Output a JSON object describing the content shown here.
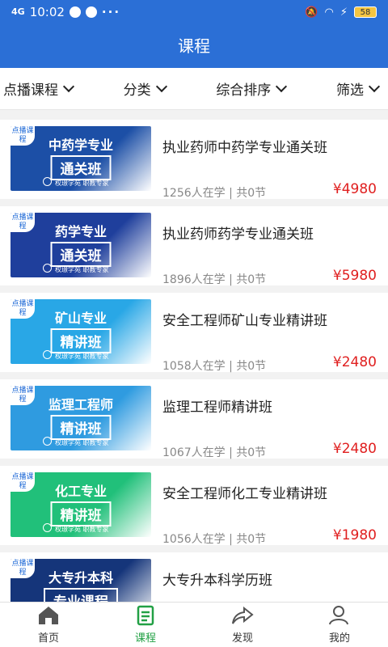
{
  "status": {
    "time": "10:02",
    "signal": "4G",
    "battery": "58"
  },
  "header": {
    "title": "课程"
  },
  "filters": [
    {
      "label": "点播课程"
    },
    {
      "label": "分类"
    },
    {
      "label": "综合排序"
    },
    {
      "label": "筛选"
    }
  ],
  "courses": [
    {
      "tag": "点播课程",
      "thumb_line1": "中药学专业",
      "thumb_line2": "通关班",
      "brand": "权璟学苑 职教专家",
      "name": "执业药师中药学专业通关班",
      "meta": "1256人在学 | 共0节",
      "price": "¥4980",
      "color": "#1c4fa6"
    },
    {
      "tag": "点播课程",
      "thumb_line1": "药学专业",
      "thumb_line2": "通关班",
      "brand": "权璟学苑 职教专家",
      "name": "执业药师药学专业通关班",
      "meta": "1896人在学 | 共0节",
      "price": "¥5980",
      "color": "#1f3f9c"
    },
    {
      "tag": "点播课程",
      "thumb_line1": "矿山专业",
      "thumb_line2": "精讲班",
      "brand": "权璟学苑 职教专家",
      "name": "安全工程师矿山专业精讲班",
      "meta": "1058人在学 | 共0节",
      "price": "¥2480",
      "color": "#29a7e6"
    },
    {
      "tag": "点播课程",
      "thumb_line1": "监理工程师",
      "thumb_line2": "精讲班",
      "brand": "权璟学苑 职教专家",
      "name": "监理工程师精讲班",
      "meta": "1067人在学 | 共0节",
      "price": "¥2480",
      "color": "#2f9be0"
    },
    {
      "tag": "点播课程",
      "thumb_line1": "化工专业",
      "thumb_line2": "精讲班",
      "brand": "权璟学苑 职教专家",
      "name": "安全工程师化工专业精讲班",
      "meta": "1056人在学 | 共0节",
      "price": "¥1980",
      "color": "#21c07a"
    },
    {
      "tag": "点播课程",
      "thumb_line1": "大专升本科",
      "thumb_line2": "专业课程",
      "brand": "",
      "name": "大专升本科学历班",
      "meta": "",
      "price": "",
      "color": "#15357a"
    }
  ],
  "nav": [
    {
      "label": "首页",
      "icon": "home-icon"
    },
    {
      "label": "课程",
      "icon": "course-icon"
    },
    {
      "label": "发现",
      "icon": "share-icon"
    },
    {
      "label": "我的",
      "icon": "user-icon"
    }
  ],
  "colors": {
    "primary": "#2b6fd6",
    "price": "#e02020",
    "active_nav": "#22a045"
  }
}
